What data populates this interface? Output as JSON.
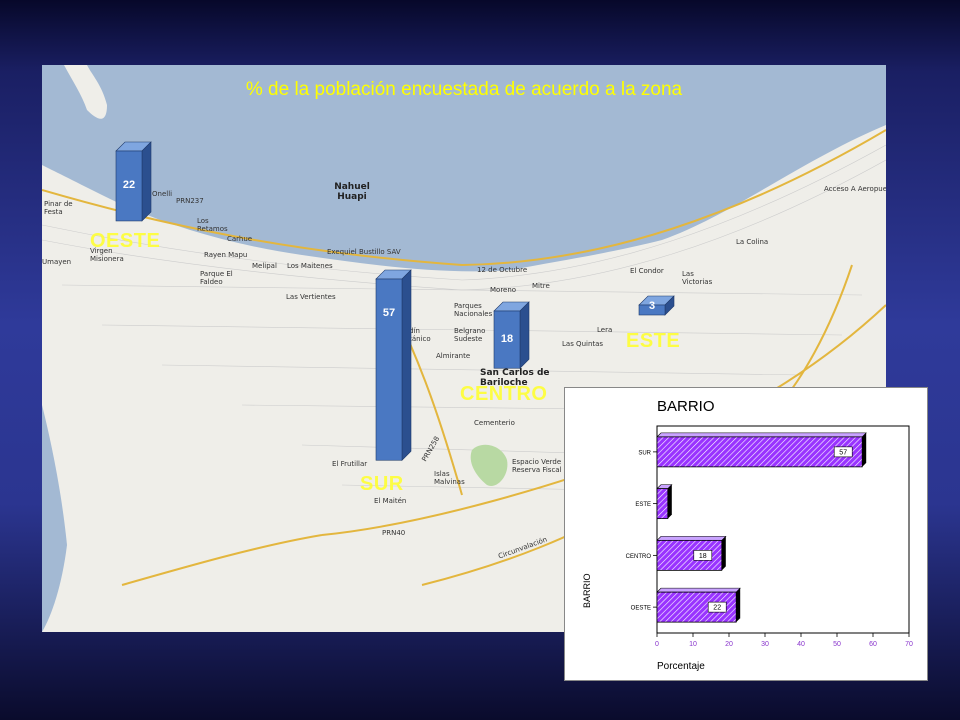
{
  "map": {
    "title": "% de la población encuestada de acuerdo a la zona",
    "zones": [
      {
        "label": "OESTE",
        "value": 22
      },
      {
        "label": "SUR",
        "value": 57
      },
      {
        "label": "CENTRO",
        "value": 18
      },
      {
        "label": "ESTE",
        "value": 3
      }
    ],
    "places": [
      "Nahuel Huapi",
      "Pinar de Festa",
      "Los Retamos",
      "Carhue",
      "Rayen Mapu",
      "Parque El Faldeo",
      "Melipal",
      "Los Maitenes",
      "Las Vertientes",
      "Virgen Misionera",
      "Parques Nacionales",
      "Belgrano Sudeste",
      "Jardín Botánico",
      "San Carlos de Bariloche",
      "Cementerio",
      "El Frutillar",
      "Espacio Verde Reserva Fiscal",
      "Islas Malvinas",
      "El Maitén",
      "El Condor",
      "Las Victorias",
      "La Colina",
      "Lera",
      "Las Quintas",
      "Moreno",
      "Mitre",
      "Almirante",
      "Circunvalación",
      "PRN237",
      "PRN40",
      "PRN258",
      "12 de Octubre",
      "Exequiel Bustillo SAV",
      "Acceso A Aeropuerto",
      "Onelli",
      "Umayen"
    ],
    "colors": {
      "bar": "#4a78c2",
      "bar_side": "#2b4f8f",
      "bar_top": "#7fa6e0",
      "zone_label": "#ffff33",
      "title": "#ffff00",
      "water": "#a3b9d3"
    }
  },
  "chart_data": {
    "type": "bar",
    "orientation": "horizontal",
    "title": "BARRIO",
    "xlabel": "Porcentaje",
    "ylabel": "BARRIO",
    "categories": [
      "SUR",
      "ESTE",
      "CENTRO",
      "OESTE"
    ],
    "values": [
      57,
      3,
      18,
      22
    ],
    "data_labels": [
      "57",
      "",
      "18",
      "22"
    ],
    "xlim": [
      0,
      70
    ],
    "xticks": [
      0,
      10,
      20,
      30,
      40,
      50,
      60,
      70
    ],
    "grid": false,
    "bar_color": "#9933ff",
    "bar_pattern": "hatched"
  }
}
